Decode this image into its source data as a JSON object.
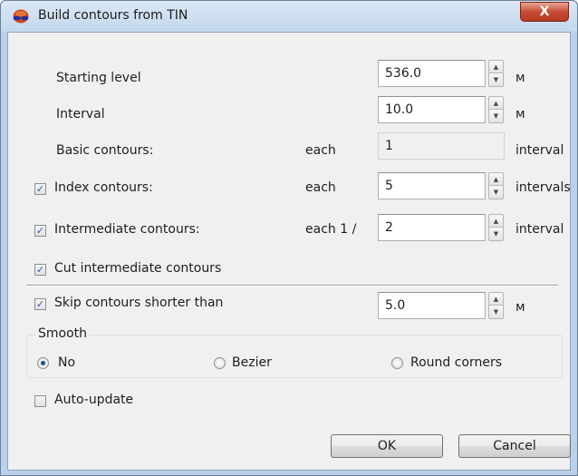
{
  "window": {
    "title": "Build contours from TIN",
    "close_label": "X"
  },
  "form": {
    "starting_level": {
      "label": "Starting level",
      "value": "536.0",
      "unit": "м"
    },
    "interval": {
      "label": "Interval",
      "value": "10.0",
      "unit": "м"
    },
    "basic_contours": {
      "label": "Basic contours:",
      "each_label": "each",
      "value": "1",
      "unit": "interval"
    },
    "index_contours": {
      "label": "Index contours:",
      "checked": true,
      "each_label": "each",
      "value": "5",
      "unit": "intervals"
    },
    "intermediate_contours": {
      "label": "Intermediate contours:",
      "checked": true,
      "each_label": "each 1 /",
      "value": "2",
      "unit": "interval"
    },
    "cut_intermediate": {
      "label": "Cut intermediate contours",
      "checked": true
    },
    "skip_shorter": {
      "label": "Skip contours shorter than",
      "checked": true,
      "value": "5.0",
      "unit": "м"
    },
    "smooth": {
      "title": "Smooth",
      "options": [
        {
          "label": "No",
          "selected": true
        },
        {
          "label": "Bezier",
          "selected": false
        },
        {
          "label": "Round corners",
          "selected": false
        }
      ]
    },
    "auto_update": {
      "label": "Auto-update",
      "checked": false
    }
  },
  "buttons": {
    "ok_label": "OK",
    "cancel_label": "Cancel"
  },
  "icons": {
    "app": "earth-glasses-icon",
    "check_mark": "✓",
    "spin_up": "▲",
    "spin_down": "▼"
  },
  "colors": {
    "titlebar": "#c4d7ec",
    "close_button": "#c74d36",
    "dialog_bg": "#f0f0f0",
    "check_accent": "#2a5b9c"
  }
}
